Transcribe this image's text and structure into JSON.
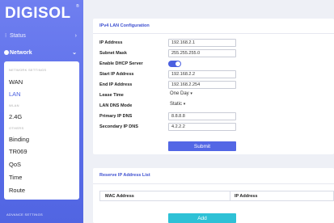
{
  "brand": {
    "logo": "DIGISOL",
    "reg": "®"
  },
  "sidebar": {
    "status_label": "Status",
    "network_label": "Network",
    "network_settings_cat": "NETWORK SETTINGS",
    "wan": "WAN",
    "lan": "LAN",
    "wlan_cat": "WLAN",
    "wlan_24": "2.4G",
    "others_cat": "OTHERS",
    "binding": "Binding",
    "tr069": "TR069",
    "qos": "QoS",
    "time": "Time",
    "route": "Route",
    "advance_settings": "ADVANCE SETTINGS"
  },
  "lan_config": {
    "title": "IPv4 LAN Configuration",
    "ip_address_label": "IP Address",
    "ip_address": "192.168.2.1",
    "subnet_mask_label": "Subnet Mask",
    "subnet_mask": "255.255.255.0",
    "dhcp_label": "Enable DHCP Server",
    "dhcp_enabled": true,
    "start_ip_label": "Start IP Address",
    "start_ip": "192.168.2.2",
    "end_ip_label": "End IP Address",
    "end_ip": "192.168.2.254",
    "lease_time_label": "Lease Time",
    "lease_time": "One Day",
    "dns_mode_label": "LAN DNS Mode",
    "dns_mode": "Static",
    "primary_dns_label": "Primary IP DNS",
    "primary_dns": "8.8.8.8",
    "secondary_dns_label": "Secondary IP DNS",
    "secondary_dns": "4.2.2.2",
    "submit": "Submit"
  },
  "reserve": {
    "title": "Reserve IP Address List",
    "col_mac": "MAC Address",
    "col_ip": "IP Address",
    "add": "Add"
  },
  "colors": {
    "accent": "#4a5fe0",
    "add_button": "#2ec1d6",
    "sidebar": "#5b6ee9"
  }
}
